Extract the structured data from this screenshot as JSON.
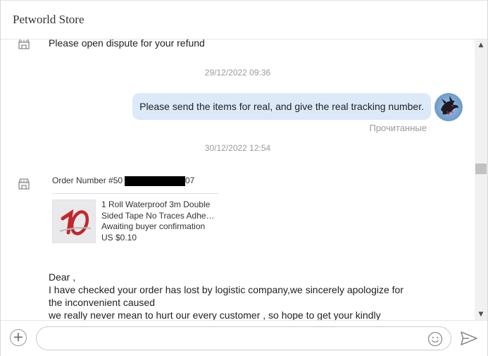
{
  "header": {
    "title": "Petworld Store"
  },
  "messages": {
    "seller_top": "Please open  dispute for your refund",
    "timestamp_1": "29/12/2022 09:36",
    "buyer_message": "Please send the items for real, and give the real tracking number.",
    "read_status": "Прочитанные",
    "timestamp_2": "30/12/2022 12:54",
    "order_card": {
      "order_prefix": "Order Number #50",
      "order_suffix": "07",
      "product_title_line1": "1 Roll Waterproof 3m Double",
      "product_title_line2": "Sided Tape No Traces Adhe…",
      "status": "Awaiting buyer confirmation",
      "price": "US $0.10"
    },
    "seller_long": {
      "line1": "Dear ,",
      "line2": "I have checked your order has lost by logistic company,we sincerely apologize for",
      "line3": "the inconvenient caused",
      "line4": "we really never mean to hurt our every customer , so hope to get your kindly"
    }
  },
  "composer": {
    "value": "",
    "placeholder": ""
  },
  "icons": {
    "store": "store-icon",
    "avatar": "dragon-avatar",
    "add": "plus-circle-icon",
    "emoji": "smiley-icon",
    "send": "send-icon",
    "scroll_up": "chevron-up-icon",
    "scroll_down": "chevron-down-icon"
  },
  "colors": {
    "bubble": "#dbe9f8",
    "timestamp": "#9a9a9a"
  }
}
